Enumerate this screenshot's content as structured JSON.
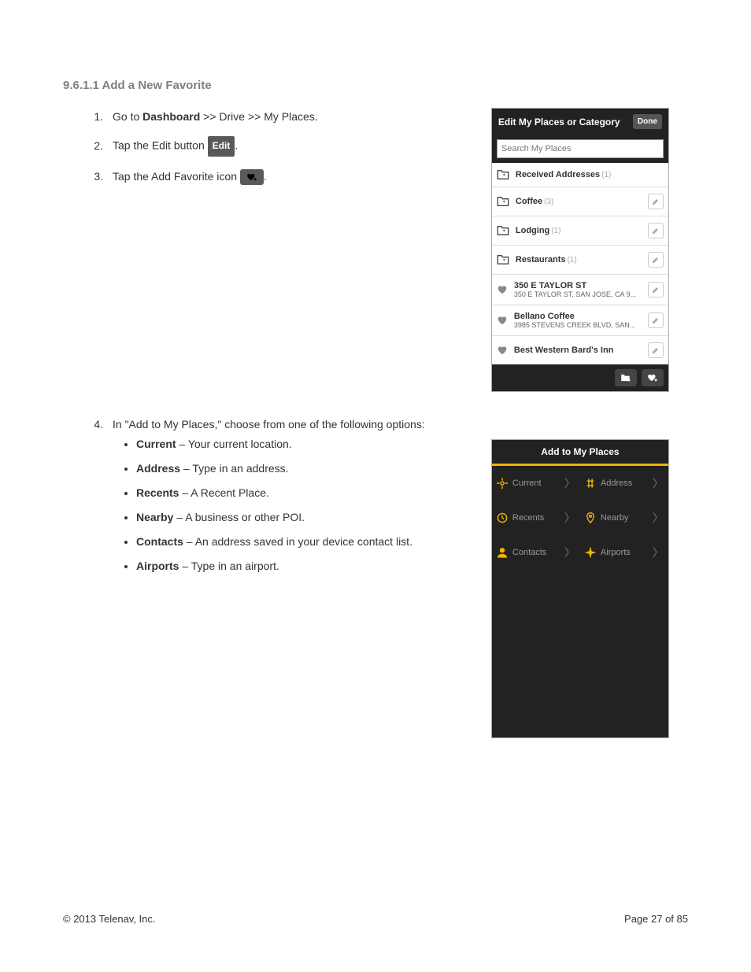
{
  "heading": "9.6.1.1 Add a New Favorite",
  "steps": {
    "s1_pre": "Go to ",
    "s1_bold": "Dashboard",
    "s1_post": " >> Drive >> My Places.",
    "s2_pre": "Tap the Edit button ",
    "s2_btn": "Edit",
    "s2_post": ".",
    "s3_pre": "Tap the Add Favorite icon ",
    "s3_post": ".",
    "s4_text": "In \"Add to My Places,\" choose from one of the following options:"
  },
  "bullets": [
    {
      "name": "Current",
      "desc": " – Your current location."
    },
    {
      "name": "Address",
      "desc": " – Type in an address."
    },
    {
      "name": "Recents",
      "desc": " – A Recent Place."
    },
    {
      "name": "Nearby",
      "desc": " – A business or other POI."
    },
    {
      "name": "Contacts",
      "desc": " – An address saved in your device contact list."
    },
    {
      "name": "Airports",
      "desc": " – Type in an airport."
    }
  ],
  "phone1": {
    "title": "Edit My Places or Category",
    "done": "Done",
    "search_placeholder": "Search My Places",
    "categories": [
      {
        "label": "Received Addresses",
        "count": "(1)",
        "editable": false
      },
      {
        "label": "Coffee",
        "count": "(3)",
        "editable": true
      },
      {
        "label": "Lodging",
        "count": "(1)",
        "editable": true
      },
      {
        "label": "Restaurants",
        "count": "(1)",
        "editable": true
      }
    ],
    "places": [
      {
        "name": "350 E TAYLOR ST",
        "addr": "350 E TAYLOR ST, SAN JOSE, CA 9..."
      },
      {
        "name": "Bellano Coffee",
        "addr": "3985 STEVENS CREEK BLVD, SAN..."
      },
      {
        "name": "Best Western Bard's Inn",
        "addr": ""
      }
    ]
  },
  "phone2": {
    "title": "Add to My Places",
    "items": [
      {
        "label": "Current"
      },
      {
        "label": "Address"
      },
      {
        "label": "Recents"
      },
      {
        "label": "Nearby"
      },
      {
        "label": "Contacts"
      },
      {
        "label": "Airports"
      }
    ]
  },
  "footer": {
    "left": "© 2013 Telenav, Inc.",
    "right": "Page 27 of 85"
  }
}
